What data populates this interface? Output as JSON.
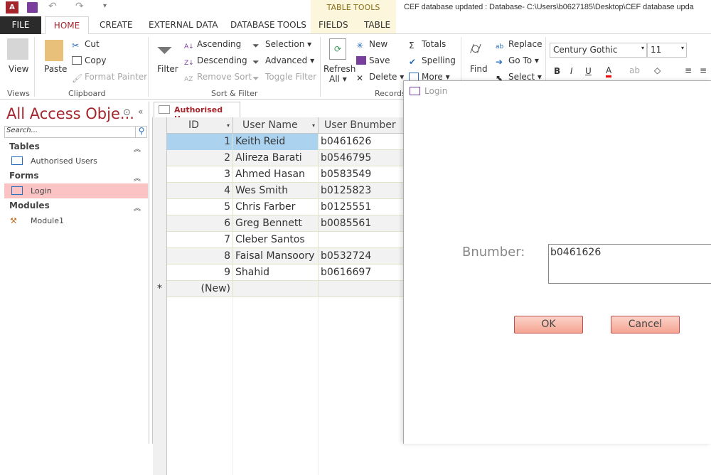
{
  "window": {
    "title": "CEF database updated : Database- C:\\Users\\b0627185\\Desktop\\CEF database upda",
    "table_tools": "TABLE TOOLS"
  },
  "tabs": [
    "FILE",
    "HOME",
    "CREATE",
    "EXTERNAL DATA",
    "DATABASE TOOLS",
    "FIELDS",
    "TABLE"
  ],
  "ribbon": {
    "views": {
      "view": "View",
      "label": "Views"
    },
    "clipboard": {
      "paste": "Paste",
      "cut": "Cut",
      "copy": "Copy",
      "format_painter": "Format Painter",
      "label": "Clipboard"
    },
    "sort_filter": {
      "filter": "Filter",
      "ascending": "Ascending",
      "descending": "Descending",
      "remove_sort": "Remove Sort",
      "selection": "Selection",
      "advanced": "Advanced",
      "toggle_filter": "Toggle Filter",
      "label": "Sort & Filter"
    },
    "records": {
      "refresh": "Refresh",
      "all": "All",
      "new": "New",
      "save": "Save",
      "delete": "Delete",
      "totals": "Totals",
      "spelling": "Spelling",
      "more": "More",
      "label": "Records"
    },
    "find": {
      "find": "Find",
      "replace": "Replace",
      "goto": "Go To",
      "select": "Select"
    },
    "text": {
      "font": "Century Gothic",
      "size": "11",
      "bold": "B",
      "italic": "I",
      "underline": "U",
      "font_color": "A"
    }
  },
  "nav": {
    "title": "All Access Obje...",
    "search_placeholder": "Search...",
    "sections": [
      {
        "label": "Tables",
        "items": [
          "Authorised Users"
        ]
      },
      {
        "label": "Forms",
        "items": [
          "Login"
        ]
      },
      {
        "label": "Modules",
        "items": [
          "Module1"
        ]
      }
    ]
  },
  "table": {
    "tab": "Authorised Users",
    "columns": [
      "ID",
      "User Name",
      "User Bnumber"
    ],
    "rows": [
      [
        "1",
        "Keith Reid",
        "b0461626"
      ],
      [
        "2",
        "Alireza Barati",
        "b0546795"
      ],
      [
        "3",
        "Ahmed Hasan",
        "b0583549"
      ],
      [
        "4",
        "Wes Smith",
        "b0125823"
      ],
      [
        "5",
        "Chris Farber",
        "b0125551"
      ],
      [
        "6",
        "Greg Bennett",
        "b0085561"
      ],
      [
        "7",
        "Cleber Santos",
        ""
      ],
      [
        "8",
        "Faisal Mansoory",
        "b0532724"
      ],
      [
        "9",
        "Shahid",
        "b0616697"
      ]
    ],
    "new_row": "(New)",
    "new_marker": "*"
  },
  "dialog": {
    "title": "Login",
    "label": "Bnumber:",
    "value": "b0461626",
    "ok": "OK",
    "cancel": "Cancel"
  }
}
